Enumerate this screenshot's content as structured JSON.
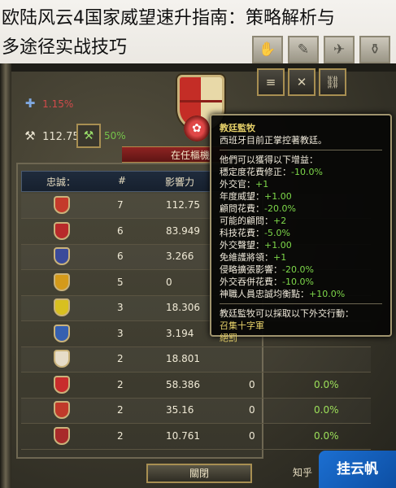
{
  "headline": {
    "line1": "欧陆风云4国家威望速升指南：策略解析与",
    "line2": "多途径实战技巧"
  },
  "stats": {
    "prestige_pct": "1.15%",
    "power_value": "112.75",
    "power_pct": "50%"
  },
  "banner_text": "在任樞機",
  "table": {
    "headers": [
      "忠誠：",
      "#",
      "影響力"
    ],
    "rows": [
      {
        "shield_color": "#c43a2b",
        "count": "7",
        "influence": "112.75",
        "extra": "",
        "pct": ""
      },
      {
        "shield_color": "#b82a2a",
        "count": "6",
        "influence": "83.949",
        "extra": "",
        "pct": ""
      },
      {
        "shield_color": "#3a4a9a",
        "count": "6",
        "influence": "3.266",
        "extra": "",
        "pct": ""
      },
      {
        "shield_color": "#d49a1a",
        "count": "5",
        "influence": "0",
        "extra": "",
        "pct": ""
      },
      {
        "shield_color": "#d8c020",
        "count": "3",
        "influence": "18.306",
        "extra": "",
        "pct": ""
      },
      {
        "shield_color": "#3660b0",
        "count": "3",
        "influence": "3.194",
        "extra": "",
        "pct": ""
      },
      {
        "shield_color": "#e6dcc8",
        "count": "2",
        "influence": "18.801",
        "extra": "",
        "pct": ""
      },
      {
        "shield_color": "#c82c2c",
        "count": "2",
        "influence": "58.386",
        "extra": "0",
        "pct": "0.0%"
      },
      {
        "shield_color": "#c03a2a",
        "count": "2",
        "influence": "35.16",
        "extra": "0",
        "pct": "0.0%"
      },
      {
        "shield_color": "#a82a2a",
        "count": "2",
        "influence": "10.761",
        "extra": "0",
        "pct": "0.0%"
      }
    ]
  },
  "tooltip": {
    "title": "教廷監牧",
    "subtitle": "西班牙目前正掌控著教廷。",
    "gains_header": "他們可以獲得以下增益：",
    "modifiers": [
      {
        "label": "穩定度花費修正：",
        "value": "-10.0%",
        "tone": "green"
      },
      {
        "label": "外交官：",
        "value": "+1",
        "tone": "green"
      },
      {
        "label": "年度威望：",
        "value": "+1.00",
        "tone": "green"
      },
      {
        "label": "顧問花費：",
        "value": "-20.0%",
        "tone": "green"
      },
      {
        "label": "可能的顧問：",
        "value": "+2",
        "tone": "green"
      },
      {
        "label": "科技花費：",
        "value": "-5.0%",
        "tone": "green"
      },
      {
        "label": "外交聲望：",
        "value": "+1.00",
        "tone": "green"
      },
      {
        "label": "免維護將領：",
        "value": "+1",
        "tone": "green"
      },
      {
        "label": "侵略擴張影響：",
        "value": "-20.0%",
        "tone": "green"
      },
      {
        "label": "外交吞併花費：",
        "value": "-10.0%",
        "tone": "green"
      },
      {
        "label": "神職人員忠誠均衡點：",
        "value": "+10.0%",
        "tone": "green"
      }
    ],
    "actions_header": "教廷監牧可以採取以下外交行動：",
    "actions": [
      "召集十字軍",
      "絕罰"
    ]
  },
  "close_label": "關閉",
  "bottom_right_label": "知乎",
  "watermark": "挂云帆"
}
